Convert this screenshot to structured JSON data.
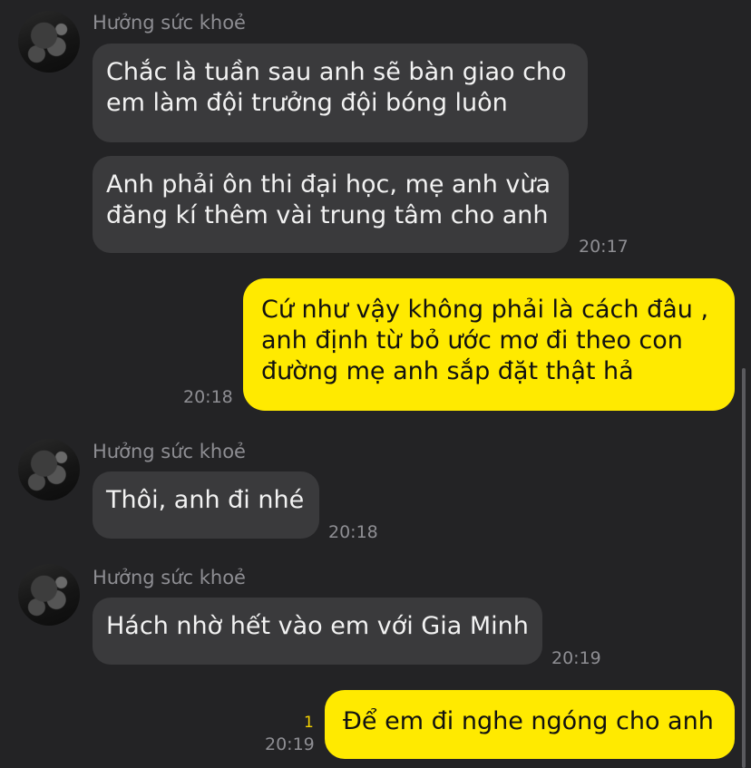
{
  "messages": [
    {
      "sender": "Hưởng sức khoẻ",
      "bubbles": [
        "Chắc là tuần sau anh sẽ bàn giao cho\nem làm đội trưởng đội bóng luôn",
        "Anh phải ôn thi đại học, mẹ anh vừa\nđăng kí thêm vài trung tâm cho anh"
      ],
      "time": "20:17"
    },
    {
      "outgoing": true,
      "text": "Cứ như vậy không phải là cách đâu ,\nanh định từ bỏ ước mơ đi theo con\nđường mẹ anh sắp đặt thật hả",
      "time": "20:18"
    },
    {
      "sender": "Hưởng sức khoẻ",
      "text": "Thôi, anh đi nhé",
      "time": "20:18"
    },
    {
      "sender": "Hưởng sức khoẻ",
      "text": "Hách nhờ hết vào em với Gia Minh",
      "time": "20:19"
    },
    {
      "outgoing": true,
      "text": "Để em đi nghe ngóng cho anh",
      "time": "20:19",
      "unread_count": "1"
    }
  ],
  "colors": {
    "background": "#232325",
    "incoming_bubble": "#3a3a3c",
    "outgoing_bubble": "#ffea00",
    "meta_text": "#8e8e93"
  }
}
